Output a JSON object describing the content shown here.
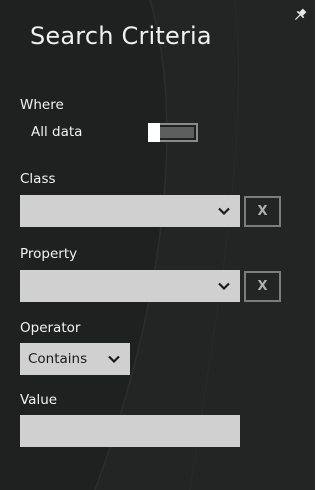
{
  "title": "Search Criteria",
  "where": {
    "label": "Where",
    "toggle_label": "All data",
    "toggle_on": false
  },
  "class_field": {
    "label": "Class",
    "value": "",
    "clear_label": "X"
  },
  "property_field": {
    "label": "Property",
    "value": "",
    "clear_label": "X"
  },
  "operator": {
    "label": "Operator",
    "selected": "Contains"
  },
  "value_field": {
    "label": "Value",
    "value": ""
  },
  "icons": {
    "pin": "pin-icon",
    "dropdown": "chevron-down-icon"
  },
  "colors": {
    "background": "#1f2120",
    "field": "#d0d0d0",
    "text": "#f2f2f2"
  }
}
